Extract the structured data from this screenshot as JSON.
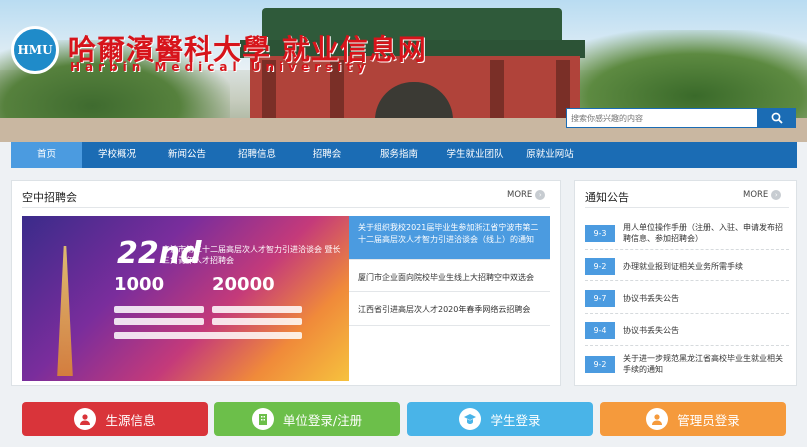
{
  "site": {
    "logo_text": "HMU",
    "name_cn": "哈爾濱醫科大學 就业信息网",
    "name_en": "Harbin  Medical  University"
  },
  "search": {
    "placeholder": "搜索你感兴趣的内容",
    "icon": "search-icon"
  },
  "nav": {
    "items": [
      {
        "label": "首页",
        "active": true
      },
      {
        "label": "学校概况"
      },
      {
        "label": "新闻公告"
      },
      {
        "label": "招聘信息"
      },
      {
        "label": "招聘会"
      },
      {
        "label": "服务指南"
      },
      {
        "label": "学生就业团队"
      },
      {
        "label": "原就业网站"
      }
    ]
  },
  "job_fair": {
    "title": "空中招聘会",
    "more_label": "MORE",
    "poster": {
      "headline": "22nd",
      "subtitle": "宁波市第二十二届高层次人才智力引进洽谈会 暨长三角青年人才招聘会",
      "stat1": "1000",
      "stat2": "20000"
    },
    "items": [
      {
        "text": "关于组织我校2021届毕业生参加浙江省宁波市第二十二届高层次人才智力引进洽谈会（线上）的通知",
        "highlight": true
      },
      {
        "text": "厦门市企业面向院校毕业生线上大招聘空中双选会"
      },
      {
        "text": "江西省引进高层次人才2020年春季网络云招聘会"
      }
    ]
  },
  "notice": {
    "title": "通知公告",
    "more_label": "MORE",
    "items": [
      {
        "date": "9-3",
        "text": "用人单位操作手册（注册、入驻、申请发布招聘信息、参加招聘会）"
      },
      {
        "date": "9-2",
        "text": "办理就业报到证相关业务所需手续"
      },
      {
        "date": "9-7",
        "text": "协议书丢失公告"
      },
      {
        "date": "9-4",
        "text": "协议书丢失公告"
      },
      {
        "date": "9-2",
        "text": "关于进一步规范黑龙江省高校毕业生就业相关手续的通知"
      }
    ]
  },
  "quick_links": [
    {
      "label": "生源信息",
      "color": "#d9343a",
      "icon": "user-icon"
    },
    {
      "label": "单位登录/注册",
      "color": "#6cbf4a",
      "icon": "building-icon"
    },
    {
      "label": "学生登录",
      "color": "#49b4e8",
      "icon": "graduate-icon"
    },
    {
      "label": "管理员登录",
      "color": "#f59a3c",
      "icon": "admin-icon"
    }
  ]
}
